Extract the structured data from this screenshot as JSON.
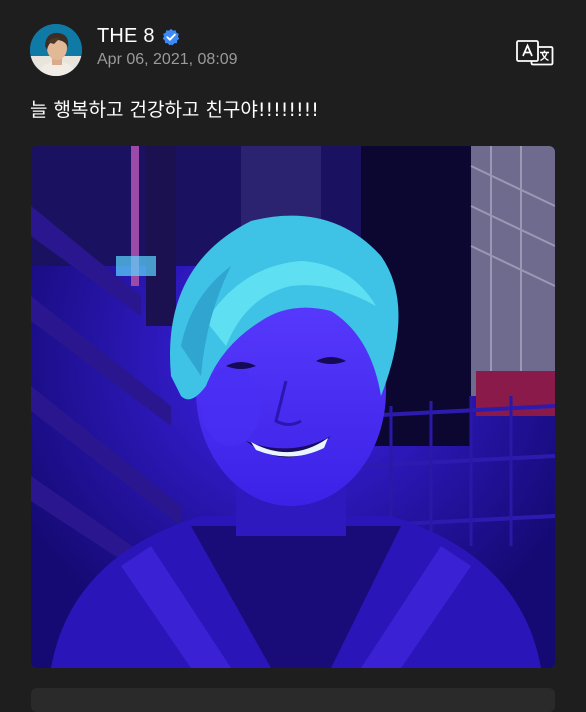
{
  "post": {
    "author": "THE 8",
    "verified": true,
    "timestamp": "Apr 06, 2021, 08:09",
    "text": "늘 행복하고 건강하고 친구야!!!!!!!!"
  },
  "icons": {
    "verified": "verified-badge-icon",
    "translate": "translate-icon"
  },
  "colors": {
    "background": "#1e1e1e",
    "verified": "#3d8af7",
    "photo_tint": "#3a1fe0",
    "timestamp": "#9a9a9a"
  }
}
